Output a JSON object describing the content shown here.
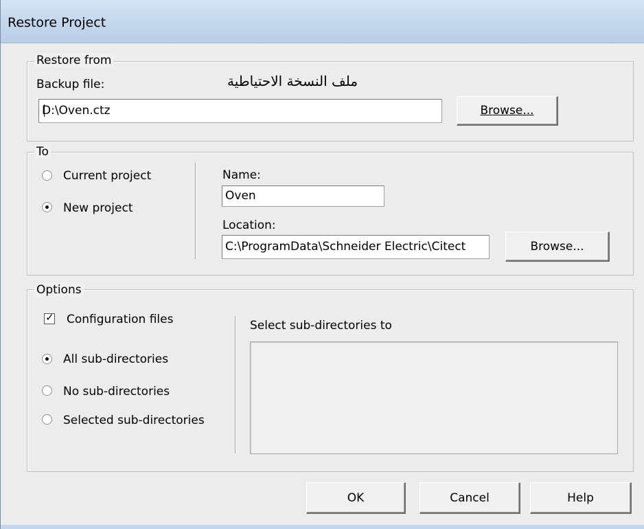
{
  "window": {
    "title": "Restore Project"
  },
  "restore_from": {
    "legend": "Restore from",
    "backup_label": "Backup file:",
    "arabic_note": "ملف النسخة الاحتياطية",
    "backup_value": "D:\\Oven.ctz",
    "browse_label": "Browse..."
  },
  "to": {
    "legend": "To",
    "current_project_label": "Current project",
    "new_project_label": "New project",
    "selected": "new_project",
    "name_label": "Name:",
    "name_value": "Oven",
    "location_label": "Location:",
    "location_value": "C:\\ProgramData\\Schneider Electric\\Citect",
    "browse_label": "Browse..."
  },
  "options": {
    "legend": "Options",
    "config_files_label": "Configuration files",
    "config_files_checked": true,
    "all_subdirs_label": "All sub-directories",
    "no_subdirs_label": "No sub-directories",
    "selected_subdirs_label": "Selected sub-directories",
    "selected_radio": "all_subdirs",
    "select_subdirs_label": "Select sub-directories to"
  },
  "buttons": {
    "ok": "OK",
    "cancel": "Cancel",
    "help": "Help"
  }
}
